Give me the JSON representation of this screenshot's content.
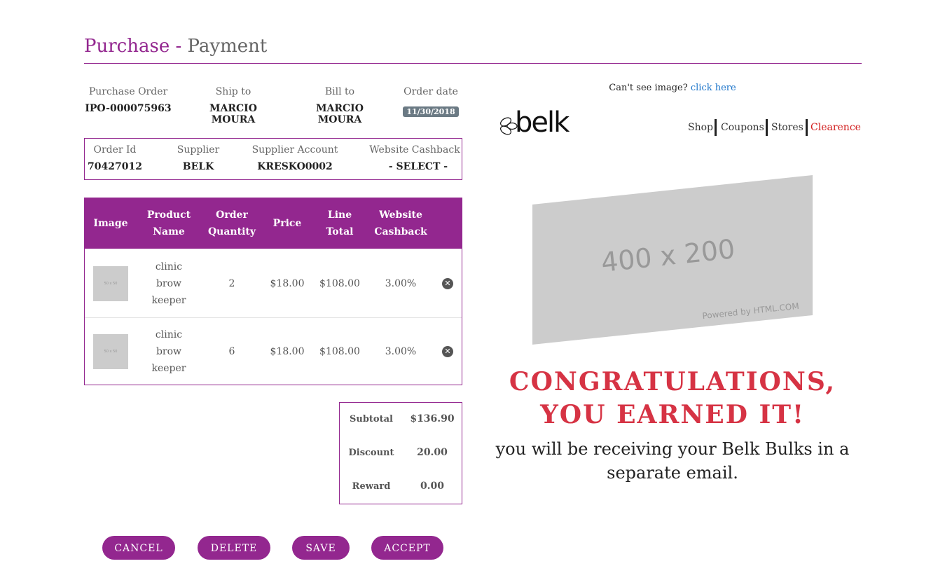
{
  "page": {
    "title_main": "Purchase",
    "title_sep": "-",
    "title_sub": "Payment"
  },
  "order_info": {
    "purchase_order_label": "Purchase Order",
    "purchase_order_value": "IPO-000075963",
    "ship_to_label": "Ship to",
    "ship_to_value": "MARCIO MOURA",
    "bill_to_label": "Bill to",
    "bill_to_value": "MARCIO MOURA",
    "order_date_label": "Order date",
    "order_date_value": "11/30/2018"
  },
  "supplier_info": {
    "order_id_label": "Order Id",
    "order_id_value": "70427012",
    "supplier_label": "Supplier",
    "supplier_value": "BELK",
    "account_label": "Supplier Account",
    "account_value": "KRESKO0002",
    "cashback_label": "Website Cashback",
    "cashback_value": "- SELECT -"
  },
  "table": {
    "headers": {
      "image": "Image",
      "product_l1": "Product",
      "product_l2": "Name",
      "qty_l1": "Order",
      "qty_l2": "Quantity",
      "price": "Price",
      "line_l1": "Line",
      "line_l2": "Total",
      "cash_l1": "Website",
      "cash_l2": "Cashback"
    },
    "rows": [
      {
        "thumb": "50 x 50",
        "name_l1": "clinic",
        "name_l2": "brow",
        "name_l3": "keeper",
        "qty": "2",
        "price": "$18.00",
        "line_total": "$108.00",
        "cashback": "3.00%",
        "remove_glyph": "✕"
      },
      {
        "thumb": "50 x 50",
        "name_l1": "clinic",
        "name_l2": "brow",
        "name_l3": "keeper",
        "qty": "6",
        "price": "$18.00",
        "line_total": "$108.00",
        "cashback": "3.00%",
        "remove_glyph": "✕"
      }
    ]
  },
  "totals": {
    "subtotal_label": "Subtotal",
    "subtotal_value": "$136.90",
    "discount_label": "Discount",
    "discount_value": "20.00",
    "reward_label": "Reward",
    "reward_value": "0.00"
  },
  "buttons": {
    "cancel": "CANCEL",
    "delete": "DELETE",
    "save": "SAVE",
    "accept": "ACCEPT"
  },
  "email_preview": {
    "cant_see_text": "Can't see image?",
    "click_here": "click here",
    "logo_text": "belk",
    "nav_shop": "Shop",
    "nav_coupons": "Coupons",
    "nav_stores": "Stores",
    "nav_clearence": "Clearence",
    "placeholder_size": "400 x 200",
    "placeholder_powered": "Powered by HTML.COM",
    "congrats_l1": "CONGRATULATIONS,",
    "congrats_l2": "YOU EARNED IT!",
    "message_l1": "you will be receiving your Belk Bulks in a",
    "message_l2": "separate email."
  },
  "colors": {
    "accent": "#93278f",
    "congrats_red": "#d63344",
    "link_blue": "#1a73c9",
    "clearence_red": "#d11a1a",
    "placeholder_gray": "#cccccc"
  },
  "icons": {
    "remove": "remove-circle-icon",
    "logo_leaf": "belk-leaf-icon"
  }
}
